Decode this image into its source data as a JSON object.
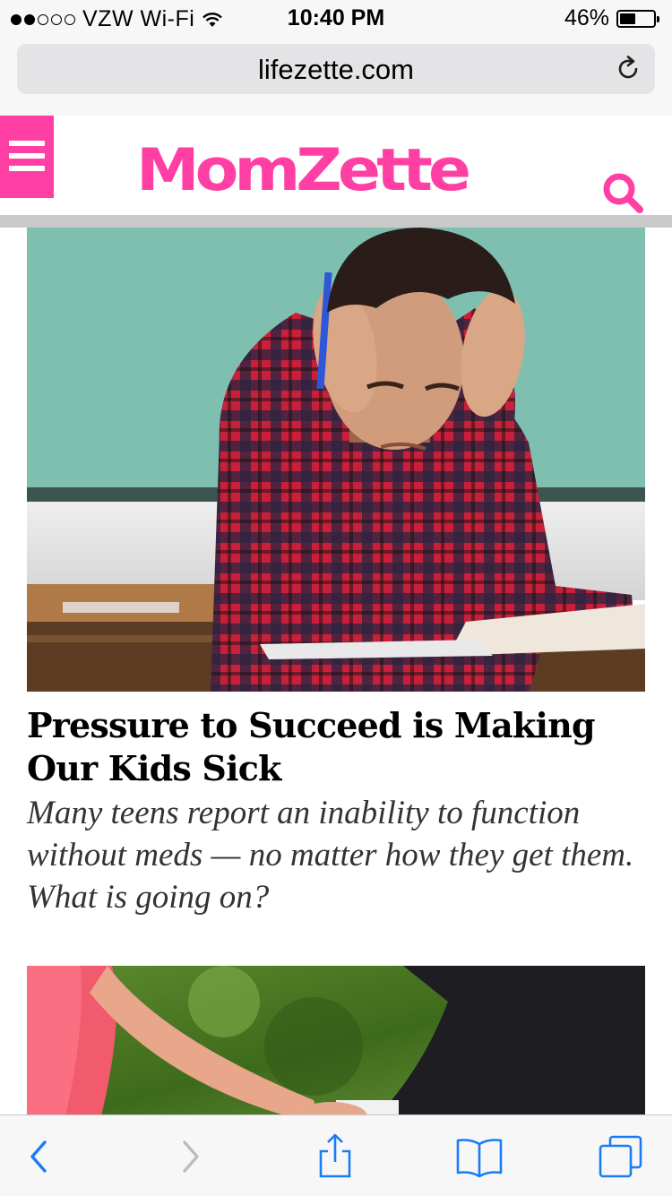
{
  "status_bar": {
    "carrier": "VZW Wi-Fi",
    "time": "10:40 PM",
    "battery": "46%",
    "battery_level": 0.46,
    "signal_bars": 2,
    "wifi_icon": "wifi-icon"
  },
  "browser": {
    "url": "lifezette.com",
    "reload_icon": "reload-icon"
  },
  "site": {
    "logo": "MomZette",
    "menu_icon": "hamburger-menu-icon",
    "search_icon": "search-icon",
    "brand_color": "#ff3fa4"
  },
  "articles": [
    {
      "image": "teen-boy-stressed-at-desk",
      "title": "Pressure to Succeed is Making Our Kids Sick",
      "dek": "Many teens report an inability to function without meds — no matter how they get them. What is going on?"
    },
    {
      "image": "couple-holding-hands-outdoors"
    }
  ],
  "toolbar": {
    "back_icon": "back-chevron-icon",
    "forward_icon": "forward-chevron-icon",
    "share_icon": "share-icon",
    "bookmarks_icon": "bookmarks-icon",
    "tabs_icon": "tabs-icon",
    "accent_color": "#1a7cf5"
  }
}
